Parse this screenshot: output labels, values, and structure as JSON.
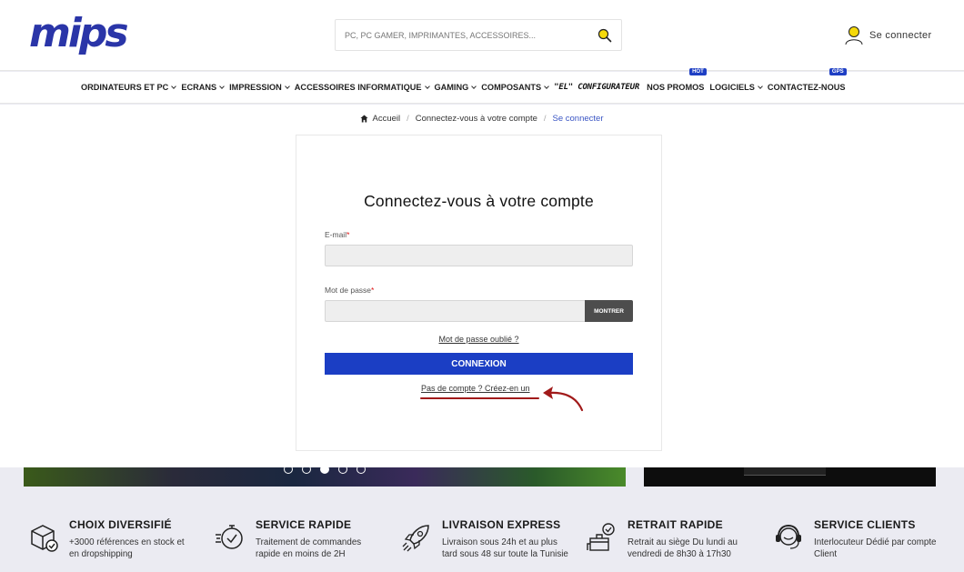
{
  "header": {
    "logo_text": "mips",
    "search_placeholder": "PC, PC GAMER, IMPRIMANTES, ACCESSOIRES...",
    "account_label": "Se connecter"
  },
  "nav": {
    "items": [
      {
        "label": "ORDINATEURS ET PC"
      },
      {
        "label": "ECRANS"
      },
      {
        "label": "IMPRESSION"
      },
      {
        "label": "ACCESSOIRES INFORMATIQUE"
      },
      {
        "label": "GAMING"
      },
      {
        "label": "COMPOSANTS"
      }
    ],
    "configurateur": "\"EL\" CONFIGURATEUR",
    "promos": "NOS PROMOS",
    "promos_badge": "HOT",
    "logiciels": "LOGICIELS",
    "contact": "CONTACTEZ-NOUS",
    "contact_badge": "GPS"
  },
  "breadcrumb": {
    "home": "Accueil",
    "middle": "Connectez-vous à votre compte",
    "current": "Se connecter"
  },
  "login": {
    "title": "Connectez-vous à votre compte",
    "email_label": "E-mail",
    "password_label": "Mot de passe",
    "required_mark": "*",
    "show_button": "MONTRER",
    "forgot_link": "Mot de passe oublié ?",
    "submit_button": "CONNEXION",
    "signup_link": "Pas de compte ? Créez-en un"
  },
  "carousel": {
    "dot_count": 5,
    "active_dot": 3
  },
  "features": [
    {
      "title": "CHOIX DIVERSIFIÉ",
      "desc": "+3000 références en stock et en dropshipping",
      "icon": "box-check-icon"
    },
    {
      "title": "SERVICE RAPIDE",
      "desc": "Traitement de commandes rapide en moins de 2H",
      "icon": "stopwatch-icon"
    },
    {
      "title": "LIVRAISON EXPRESS",
      "desc": "Livraison sous 24h et au plus tard sous 48 sur toute la Tunisie",
      "icon": "rocket-icon"
    },
    {
      "title": "RETRAIT RAPIDE",
      "desc": "Retrait au siège Du lundi au vendredi de 8h30 à 17h30",
      "icon": "store-pickup-icon"
    },
    {
      "title": "SERVICE CLIENTS",
      "desc": "Interlocuteur Dédié par compte Client",
      "icon": "headset-icon"
    }
  ],
  "colors": {
    "brand_blue": "#1b3ec4",
    "logo_blue": "#2a35a8",
    "accent_yellow": "#f5d90a",
    "annotation_red": "#a11a1a"
  }
}
